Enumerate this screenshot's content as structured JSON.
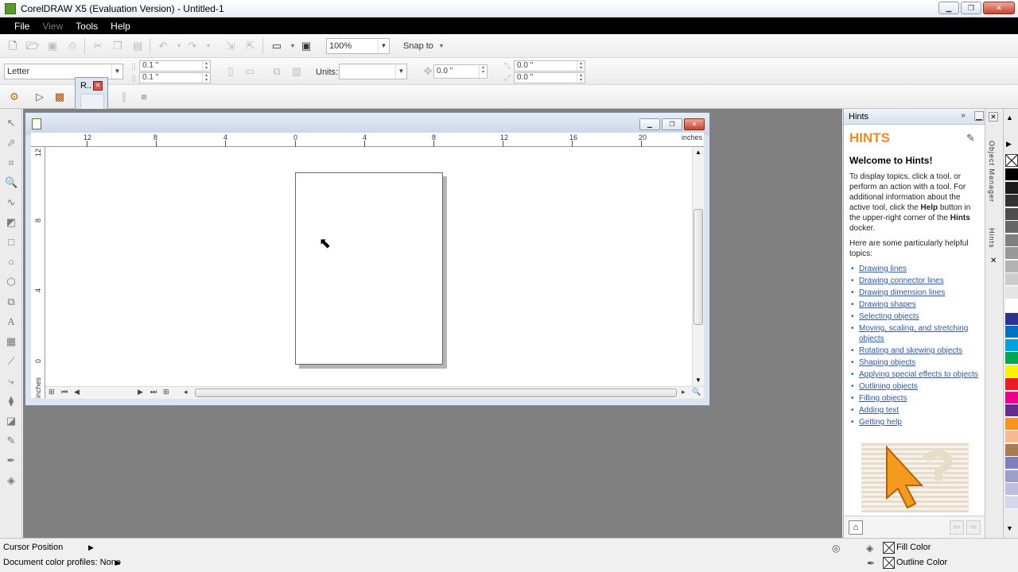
{
  "app": {
    "title": "CorelDRAW X5 (Evaluation Version) - Untitled-1"
  },
  "window_controls": {
    "minimize": "▁",
    "maximize": "❐",
    "close": "✕"
  },
  "menu": [
    {
      "label": "File",
      "enabled": true
    },
    {
      "label": "View",
      "enabled": false
    },
    {
      "label": "Tools",
      "enabled": true
    },
    {
      "label": "Help",
      "enabled": true
    }
  ],
  "standard_toolbar": {
    "zoom": "100%",
    "snap_to": "Snap to"
  },
  "property_bar": {
    "page_size": "Letter",
    "nudge1": "0.1 \"",
    "nudge2": "0.1 \"",
    "units_label": "Units:",
    "units_value": "",
    "offset": "0.0 \"",
    "dup_x": "0.0 \"",
    "dup_y": "0.0 \""
  },
  "tool_popup": {
    "label": "R.."
  },
  "ruler": {
    "top_labels": [
      "12",
      "8",
      "4",
      "0",
      "4",
      "8",
      "12",
      "16",
      "20"
    ],
    "top_unit": "inches",
    "left_labels": [
      "12",
      "8",
      "4",
      "0"
    ],
    "left_unit": "inches"
  },
  "hints": {
    "header": "Hints",
    "title": "HINTS",
    "welcome": "Welcome to Hints!",
    "para1_a": "To display topics, click a tool, or perform an action with a tool. For additional information about the active tool, click the ",
    "para1_help": "Help",
    "para1_b": " button in the upper-right corner of the ",
    "para1_hints": "Hints",
    "para1_c": " docker.",
    "para2": "Here are some particularly helpful topics:",
    "topics": [
      "Drawing lines",
      "Drawing connector lines",
      "Drawing dimension lines",
      "Drawing shapes",
      "Selecting objects",
      "Moving, scaling, and stretching objects",
      "Rotating and skewing objects",
      "Shaping objects",
      "Applying special effects to objects",
      "Outlining objects",
      "Filling objects",
      "Adding text",
      "Getting help"
    ]
  },
  "docker_tabs": {
    "object_manager": "Object Manager",
    "hints": "Hints"
  },
  "palette": {
    "colors": [
      "#000000",
      "#1a1a1a",
      "#333333",
      "#4d4d4d",
      "#666666",
      "#808080",
      "#999999",
      "#b3b3b3",
      "#cccccc",
      "#e6e6e6",
      "#ffffff",
      "#2e3192",
      "#0072bc",
      "#00a0e4",
      "#00a651",
      "#fff200",
      "#ed1c24",
      "#ec008c",
      "#662d91",
      "#f7941d",
      "#fbb98e",
      "#a67c52",
      "#7f7fbf",
      "#9e9ec8",
      "#bfbfdf",
      "#d7d7ec"
    ]
  },
  "status": {
    "cursor_position": "Cursor Position",
    "color_profiles": "Document color profiles: None",
    "fill_color": "Fill Color",
    "outline_color": "Outline Color"
  }
}
